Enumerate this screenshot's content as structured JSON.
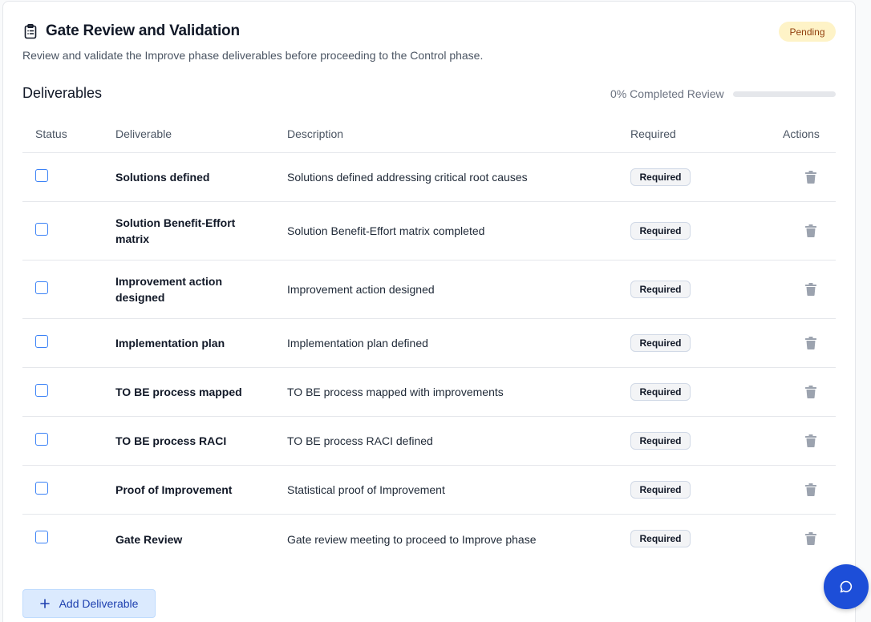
{
  "header": {
    "title": "Gate Review and Validation",
    "status_badge": "Pending",
    "subtitle": "Review and validate the Improve phase deliverables before proceeding to the Control phase."
  },
  "deliverables_section": {
    "title": "Deliverables",
    "progress_label": "0% Completed Review",
    "progress_fraction": 0
  },
  "table": {
    "columns": [
      "Status",
      "Deliverable",
      "Description",
      "Required",
      "Actions"
    ],
    "rows": [
      {
        "checked": false,
        "deliverable": "Solutions defined",
        "description": "Solutions defined addressing critical root causes",
        "required": "Required"
      },
      {
        "checked": false,
        "deliverable": "Solution Benefit-Effort matrix",
        "description": "Solution Benefit-Effort matrix completed",
        "required": "Required"
      },
      {
        "checked": false,
        "deliverable": "Improvement action designed",
        "description": "Improvement action designed",
        "required": "Required"
      },
      {
        "checked": false,
        "deliverable": "Implementation plan",
        "description": "Implementation plan defined",
        "required": "Required"
      },
      {
        "checked": false,
        "deliverable": "TO BE process mapped",
        "description": "TO BE process mapped with improvements",
        "required": "Required"
      },
      {
        "checked": false,
        "deliverable": "TO BE process RACI",
        "description": "TO BE process RACI defined",
        "required": "Required"
      },
      {
        "checked": false,
        "deliverable": "Proof of Improvement",
        "description": "Statistical proof of Improvement",
        "required": "Required"
      },
      {
        "checked": false,
        "deliverable": "Gate Review",
        "description": "Gate review meeting to proceed to Improve phase",
        "required": "Required"
      }
    ]
  },
  "actions": {
    "add_label": "Add Deliverable"
  },
  "icons": {
    "header": "clipboard-list-icon",
    "row_action": "trash-icon",
    "add": "plus-icon",
    "fab": "chat-bubble-icon"
  },
  "colors": {
    "accent": "#1d4ed8",
    "pending_bg": "#fef3c7",
    "pending_text": "#92400e",
    "checkbox_border": "#3b82f6"
  }
}
